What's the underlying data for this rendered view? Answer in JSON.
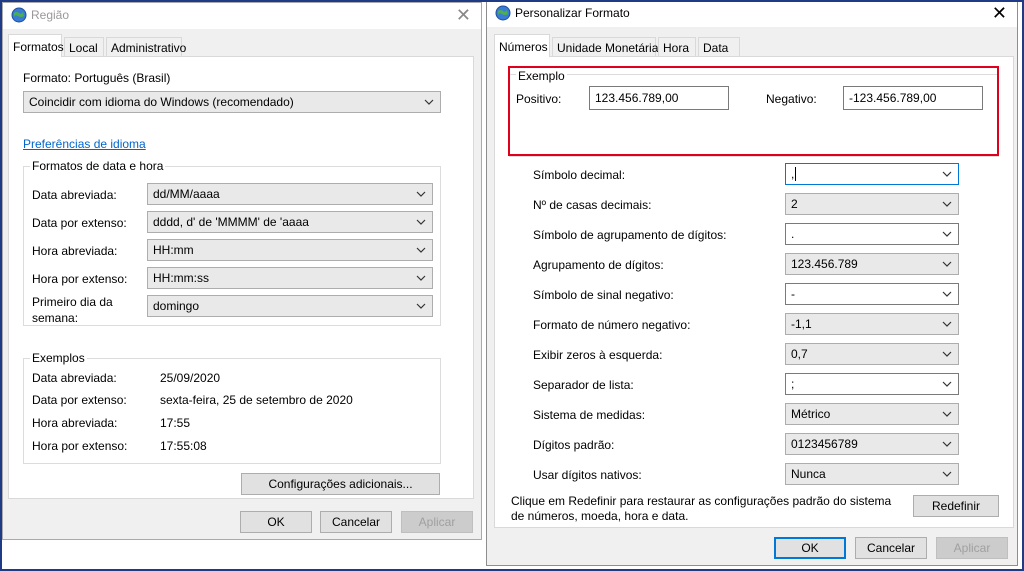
{
  "region": {
    "title": "Região",
    "tabs": [
      "Formatos",
      "Local",
      "Administrativo"
    ],
    "format_label": "Formato: Português (Brasil)",
    "format_select": "Coincidir com idioma do Windows (recomendado)",
    "language_link": "Preferências de idioma",
    "date_time_group": "Formatos de data e hora",
    "date_time_rows": [
      {
        "label": "Data abreviada:",
        "value": "dd/MM/aaaa"
      },
      {
        "label": "Data por extenso:",
        "value": "dddd, d' de 'MMMM' de 'aaaa"
      },
      {
        "label": "Hora abreviada:",
        "value": "HH:mm"
      },
      {
        "label": "Hora por extenso:",
        "value": "HH:mm:ss"
      },
      {
        "label_line1": "Primeiro dia da",
        "label_line2": "semana:",
        "value": "domingo"
      }
    ],
    "examples_group": "Exemplos",
    "examples": [
      {
        "label": "Data abreviada:",
        "value": "25/09/2020"
      },
      {
        "label": "Data por extenso:",
        "value": "sexta-feira, 25 de setembro de 2020"
      },
      {
        "label": "Hora abreviada:",
        "value": "17:55"
      },
      {
        "label": "Hora por extenso:",
        "value": "17:55:08"
      }
    ],
    "additional_button": "Configurações adicionais...",
    "ok": "OK",
    "cancel": "Cancelar",
    "apply": "Aplicar"
  },
  "custom": {
    "title": "Personalizar Formato",
    "tabs": [
      "Números",
      "Unidade Monetária",
      "Hora",
      "Data"
    ],
    "example_group": "Exemplo",
    "positive_label": "Positivo:",
    "positive_value": "123.456.789,00",
    "negative_label": "Negativo:",
    "negative_value": "-123.456.789,00",
    "settings": [
      {
        "label": "Símbolo decimal:",
        "value": ","
      },
      {
        "label": "Nº de casas decimais:",
        "value": "2"
      },
      {
        "label": "Símbolo de agrupamento de dígitos:",
        "value": "."
      },
      {
        "label": "Agrupamento de dígitos:",
        "value": "123.456.789"
      },
      {
        "label": "Símbolo de sinal negativo:",
        "value": "-"
      },
      {
        "label": "Formato de número negativo:",
        "value": "-1,1"
      },
      {
        "label": "Exibir zeros à esquerda:",
        "value": "0,7"
      },
      {
        "label": "Separador de lista:",
        "value": ";"
      },
      {
        "label": "Sistema de medidas:",
        "value": "Métrico"
      },
      {
        "label": "Dígitos padrão:",
        "value": "0123456789"
      },
      {
        "label": "Usar dígitos nativos:",
        "value": "Nunca"
      }
    ],
    "reset_text_line1": "Clique em Redefinir para restaurar as configurações padrão do sistema",
    "reset_text_line2": "de números, moeda, hora e data.",
    "reset_button": "Redefinir",
    "ok": "OK",
    "cancel": "Cancelar",
    "apply": "Aplicar"
  },
  "colors": {
    "accent": "#0078d7",
    "highlight_box": "#e0001b",
    "link": "#0066cc",
    "frame": "#1f3a86"
  }
}
